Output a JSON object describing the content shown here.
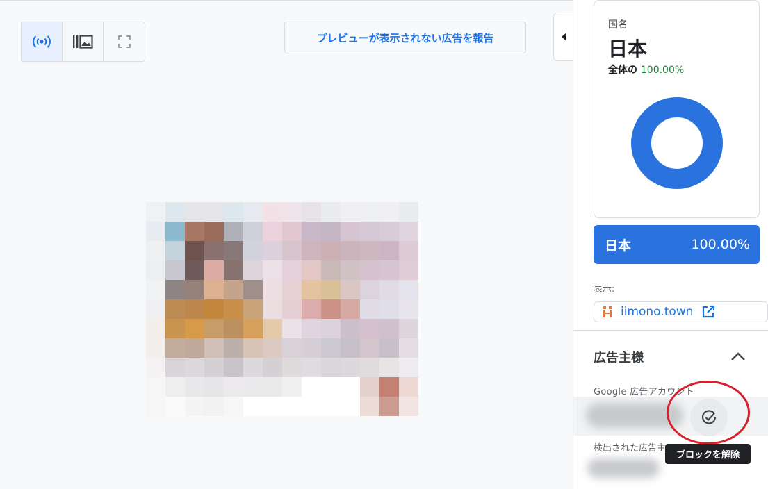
{
  "toolbar": {
    "buttons": [
      {
        "icon": "broadcast-icon",
        "active": true
      },
      {
        "icon": "gallery-icon",
        "active": false
      },
      {
        "icon": "fullscreen-icon",
        "active": false
      }
    ]
  },
  "report_button_label": "プレビューが表示されない広告を報告",
  "geo_card": {
    "label": "国名",
    "country": "日本",
    "share_prefix": "全体の",
    "share_value": "100.00%",
    "donut_fraction": 1.0
  },
  "country_row": {
    "name": "日本",
    "percent": "100.00%"
  },
  "display": {
    "label": "表示:",
    "domain": "iimono.town"
  },
  "advertiser": {
    "title": "広告主様",
    "account_label": "Google 広告アカウント",
    "detected_label": "検出された広告主",
    "unblock_tooltip": "ブロックを解除"
  },
  "colors": {
    "accent": "#1a73e8",
    "country_bar": "#2a73df",
    "share_green": "#188038",
    "annotation_red": "#d6202c"
  },
  "preview_mosaic": [
    [
      "#eef2f5",
      "#dce8ee",
      "#e6e6ea",
      "#e6e6ea",
      "#dde8ee",
      "#e6eaf0",
      "#f2e2e8",
      "#f0e4ea",
      "#e6e2e8",
      "#eaecf0",
      "#f0f0f2",
      "#eef0f2",
      "#f0f0f2",
      "#e8eef0"
    ],
    [
      "#e8ecf0",
      "#8ab8cc",
      "#a87864",
      "#9a6c5c",
      "#b0b0b8",
      "#cfd0dc",
      "#ecd2dc",
      "#e2c6d0",
      "#cab8c8",
      "#c4b6c4",
      "#d6c4d0",
      "#d6c8d4",
      "#d8ccd6",
      "#e0d4de"
    ],
    [
      "#eef0f2",
      "#c4d2dc",
      "#6e524e",
      "#8a706e",
      "#887878",
      "#d2d2dc",
      "#dcd0dc",
      "#d8c4cc",
      "#ceb4bc",
      "#ccb0b4",
      "#ccb4bc",
      "#ceb8c0",
      "#ccb4c4",
      "#dccad4"
    ],
    [
      "#eceef0",
      "#c8c6ce",
      "#6e5a58",
      "#dcaca4",
      "#86726e",
      "#dcd4d8",
      "#ecdfe6",
      "#e4d0da",
      "#e4c8c6",
      "#c8b8b6",
      "#d0c2c4",
      "#d6c2ce",
      "#d6c4d2",
      "#e0ccd4"
    ],
    [
      "#f0f2f4",
      "#8e8484",
      "#96827a",
      "#dcb090",
      "#c4a48a",
      "#a08e8a",
      "#ecdee2",
      "#e6d2d4",
      "#e4c4a0",
      "#d8c098",
      "#dac6c2",
      "#dcd4dc",
      "#e0dce6",
      "#e4e2ea"
    ],
    [
      "#f0f0f2",
      "#bc8c54",
      "#bc884e",
      "#c4883c",
      "#c8904a",
      "#c8a478",
      "#ecdde0",
      "#e4d0d4",
      "#dcacac",
      "#cc9288",
      "#d6aaa2",
      "#e0dce6",
      "#e0dee8",
      "#e8e6ec"
    ],
    [
      "#f4eeea",
      "#c89450",
      "#d69a48",
      "#c89c68",
      "#bc9060",
      "#d6a05c",
      "#e4caa8",
      "#eae2e6",
      "#e0d4de",
      "#dcd2de",
      "#ccc0cc",
      "#d4c0cc",
      "#d0c0cc",
      "#ddd4dc"
    ],
    [
      "#f2eeec",
      "#c4ac9c",
      "#c0a89a",
      "#d0c0b8",
      "#bcb0ac",
      "#d8c4b4",
      "#dccac2",
      "#d8d2d8",
      "#d6d0d6",
      "#ccc8d0",
      "#c8c0c8",
      "#d4c4cc",
      "#c8c0c8",
      "#e4dee2"
    ],
    [
      "#f4f2f2",
      "#d8d4d8",
      "#dcd8dc",
      "#d4d0d4",
      "#c8c4c8",
      "#dcd8dc",
      "#d4d0d4",
      "#dedadc",
      "#dedcde",
      "#dad6da",
      "#dcd8dc",
      "#e0dcde",
      "#e8e4e6",
      "#eeecee"
    ],
    [
      "#f6f6f6",
      "#eeeeee",
      "#e8e8ea",
      "#e6e6e8",
      "#eceaec",
      "#eaeaec",
      "#eaeaea",
      "#f0f0f0",
      "#ffffff",
      "#ffffff",
      "#ffffff",
      "#e4d0cc",
      "#c48070",
      "#eed8d4"
    ],
    [
      "#f6f6f6",
      "#fafafa",
      "#f4f4f4",
      "#f2f2f2",
      "#f6f6f6",
      "#ffffff",
      "#ffffff",
      "#ffffff",
      "#ffffff",
      "#ffffff",
      "#ffffff",
      "#ecdcd8",
      "#cc9c90",
      "#f2e4e2"
    ]
  ]
}
